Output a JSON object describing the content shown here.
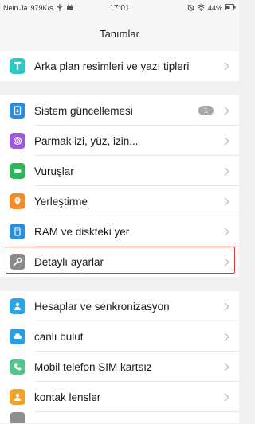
{
  "status_bar": {
    "carrier": "Nein Ja",
    "speed": "979K/s",
    "time": "17:01",
    "battery": "44%",
    "icons": [
      "signal-icon",
      "usb-icon",
      "android-debug-icon",
      "alarm-off-icon",
      "wifi-icon",
      "battery-icon"
    ]
  },
  "header": {
    "title": "Tanımlar"
  },
  "groups": [
    {
      "items": [
        {
          "label": "Arka plan resimleri ve yazı tipleri",
          "icon": "theme-icon",
          "color": "#2ec7c4"
        }
      ]
    },
    {
      "items": [
        {
          "label": "Sistem güncellemesi",
          "icon": "system-update-icon",
          "color": "#2e8bdc",
          "badge": "1"
        },
        {
          "label": "Parmak izi, yüz, izin...",
          "icon": "fingerprint-icon",
          "color": "#9b5bd6"
        },
        {
          "label": "Vuruşlar",
          "icon": "gesture-icon",
          "color": "#2fb45a"
        },
        {
          "label": "Yerleştirme",
          "icon": "location-icon",
          "color": "#f28b2a"
        },
        {
          "label": "RAM ve diskteki yer",
          "icon": "storage-icon",
          "color": "#2a8fde"
        },
        {
          "label": "Detaylı ayarlar",
          "icon": "wrench-icon",
          "color": "#8a8a8a",
          "highlighted": true
        }
      ]
    },
    {
      "items": [
        {
          "label": "Hesaplar ve senkronizasyon",
          "icon": "account-icon",
          "color": "#2aa6e4"
        },
        {
          "label": "canlı bulut",
          "icon": "cloud-icon",
          "color": "#2a9ee4"
        },
        {
          "label": "Mobil telefon SIM kartsız",
          "icon": "phone-icon",
          "color": "#56c58a"
        },
        {
          "label": "kontak lensler",
          "icon": "contacts-icon",
          "color": "#f2a42a"
        }
      ]
    }
  ]
}
